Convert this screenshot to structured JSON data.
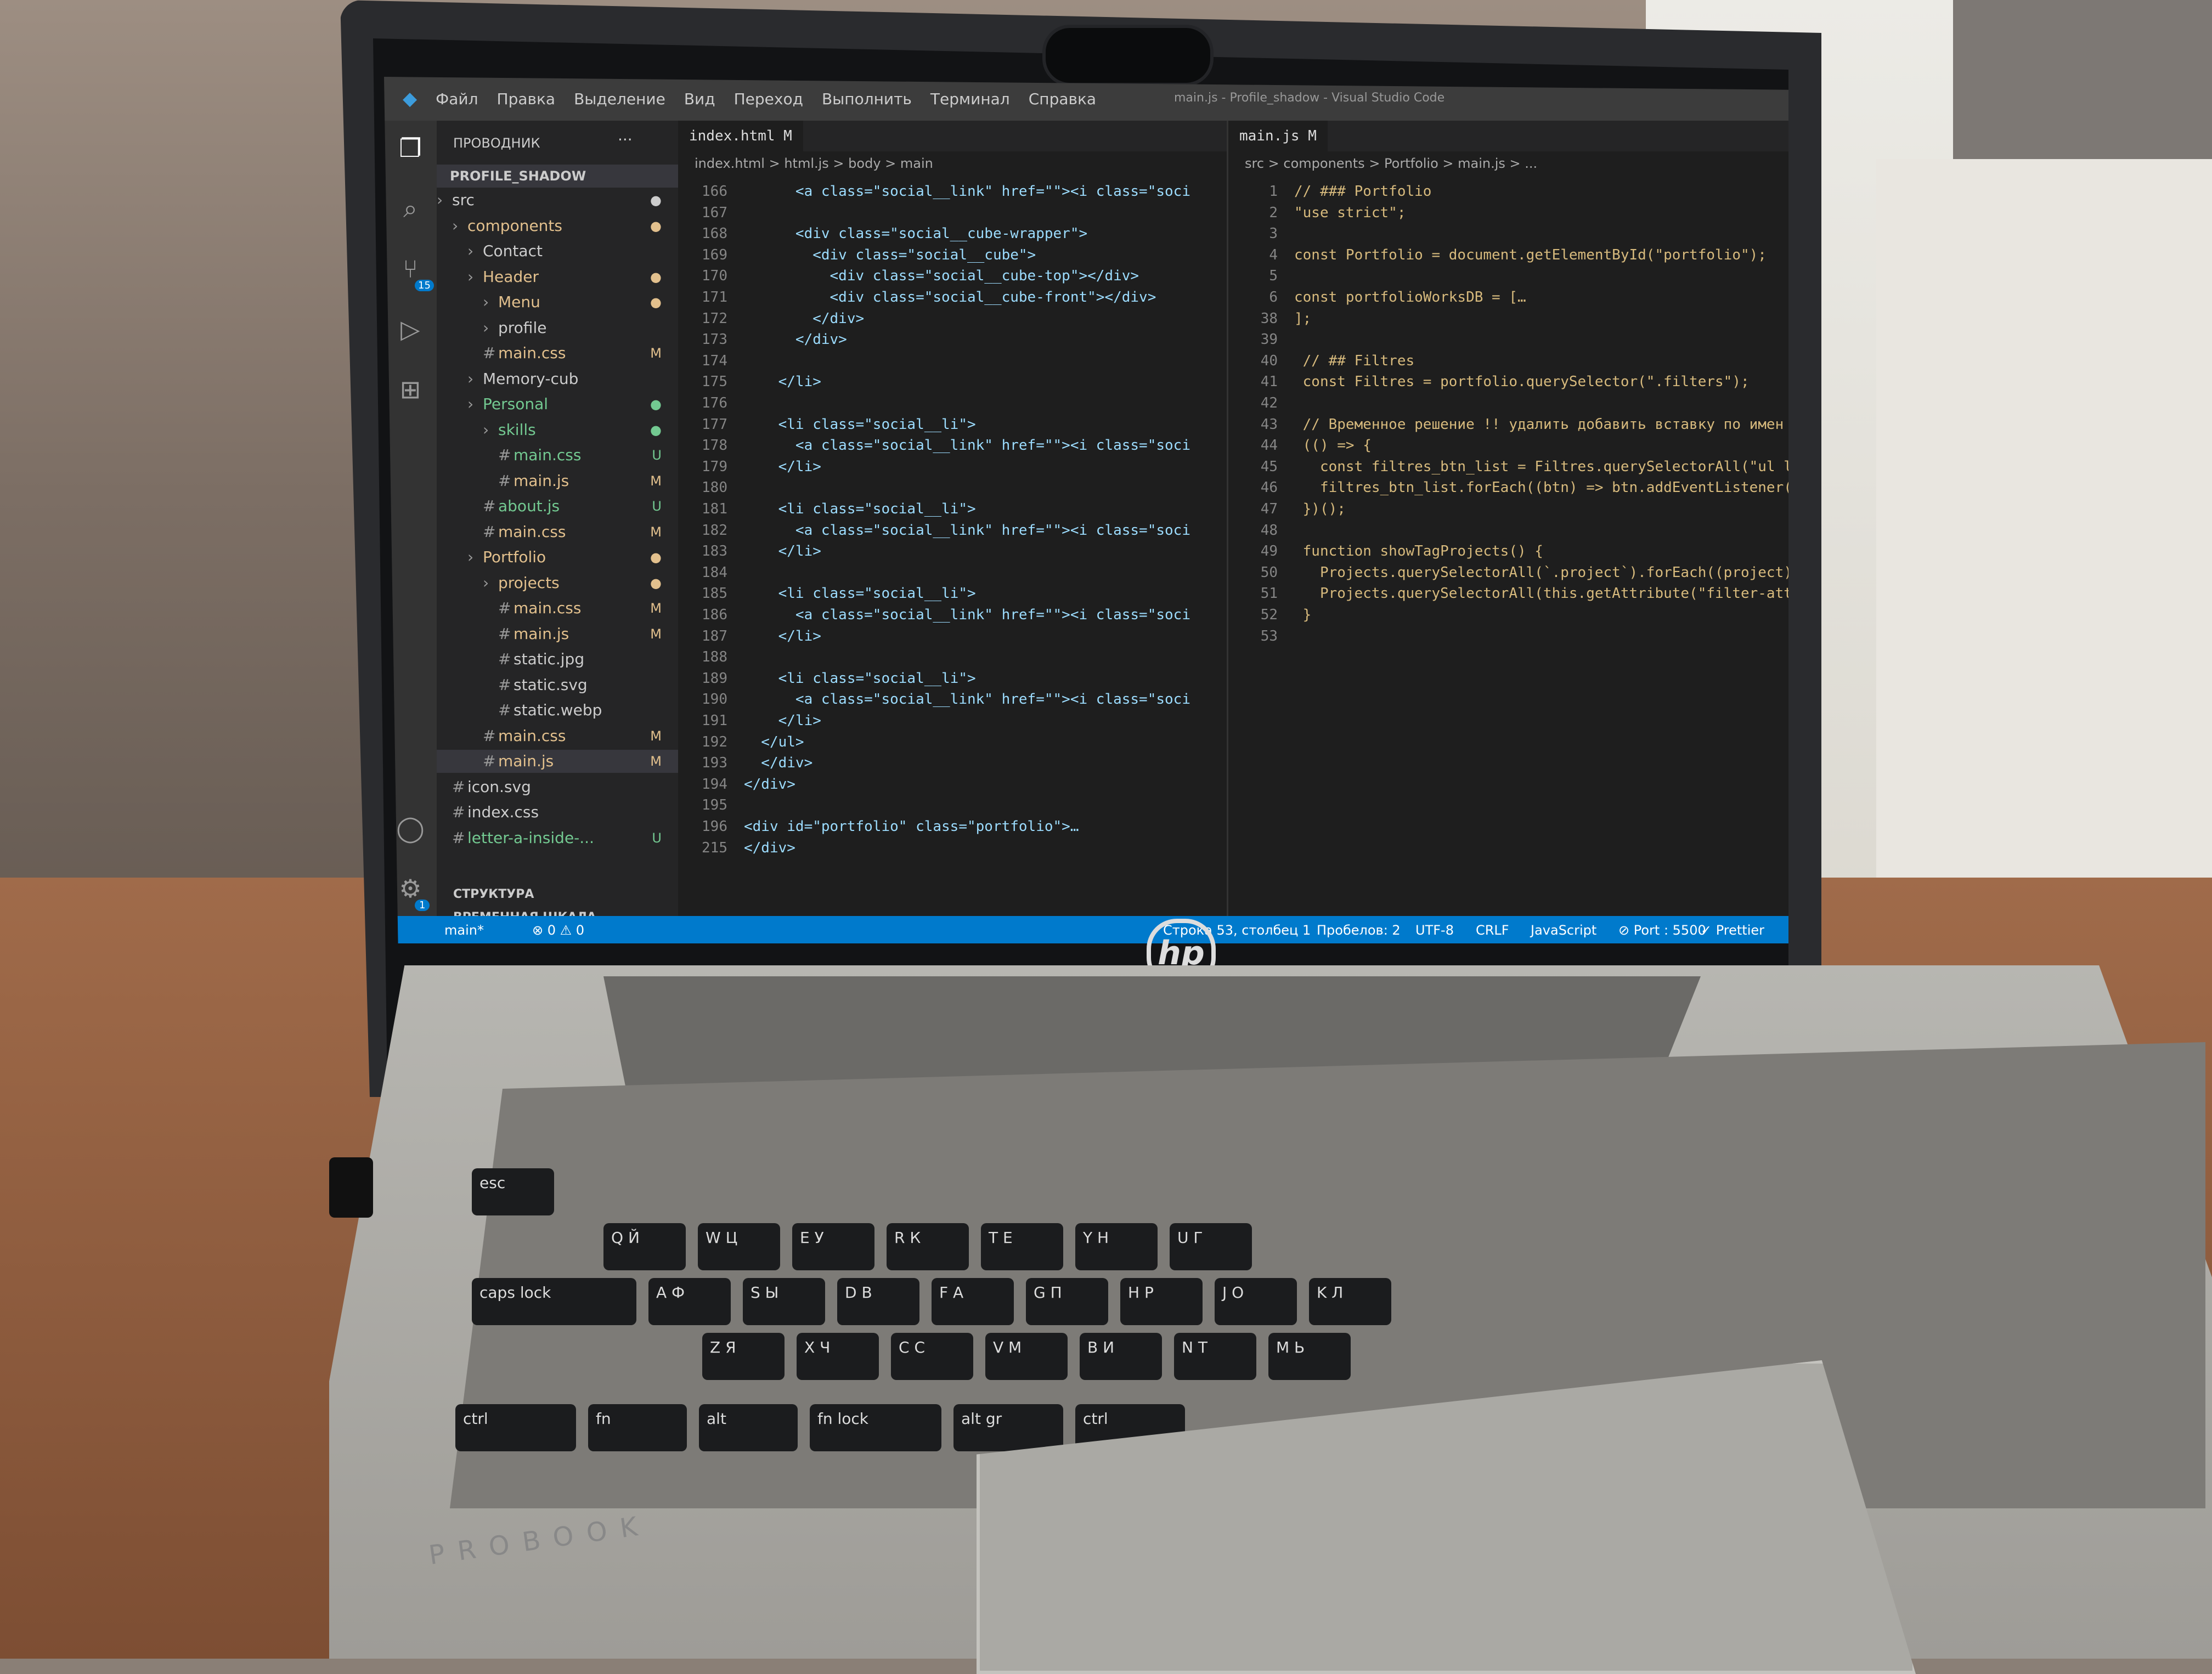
{
  "menu": [
    "Файл",
    "Правка",
    "Выделение",
    "Вид",
    "Переход",
    "Выполнить",
    "Терминал",
    "Справка"
  ],
  "window_title": "main.js - Profile_shadow - Visual Studio Code",
  "explorer": {
    "header": "ПРОВОДНИК",
    "project": "PROFILE_SHADOW",
    "items": [
      {
        "label": "src",
        "badge": "●"
      },
      {
        "label": "components",
        "badge": "●"
      },
      {
        "label": "Contact",
        "badge": ""
      },
      {
        "label": "Header",
        "badge": "●"
      },
      {
        "label": "Menu",
        "badge": "●"
      },
      {
        "label": "profile",
        "badge": ""
      },
      {
        "label": "main.css",
        "badge": "M"
      },
      {
        "label": "Memory-cub",
        "badge": ""
      },
      {
        "label": "Personal",
        "badge": "●"
      },
      {
        "label": "skills",
        "badge": "●"
      },
      {
        "label": "main.css",
        "badge": "U"
      },
      {
        "label": "main.js",
        "badge": "M"
      },
      {
        "label": "about.js",
        "badge": "U"
      },
      {
        "label": "main.css",
        "badge": "M"
      },
      {
        "label": "Portfolio",
        "badge": "●"
      },
      {
        "label": "projects",
        "badge": "●"
      },
      {
        "label": "main.css",
        "badge": "M"
      },
      {
        "label": "main.js",
        "badge": "M"
      },
      {
        "label": "static.jpg",
        "badge": ""
      },
      {
        "label": "static.svg",
        "badge": ""
      },
      {
        "label": "static.webp",
        "badge": ""
      },
      {
        "label": "main.css",
        "badge": "M"
      },
      {
        "label": "main.js",
        "badge": "M"
      },
      {
        "label": "icon.svg",
        "badge": ""
      },
      {
        "label": "index.css",
        "badge": ""
      },
      {
        "label": "letter-a-inside-...",
        "badge": "U"
      }
    ],
    "outline": "СТРУКТУРА",
    "timeline": "ВРЕМЕННАЯ ШКАЛА"
  },
  "editor1": {
    "tab": "index.html M",
    "breadcrumb": "index.html > html.js > body > main",
    "line_numbers": [
      "166",
      "167",
      "168",
      "169",
      "170",
      "171",
      "172",
      "173",
      "174",
      "175",
      "176",
      "177",
      "178",
      "179",
      "180",
      "181",
      "182",
      "183",
      "184",
      "185",
      "186",
      "187",
      "188",
      "189",
      "190",
      "191",
      "192",
      "193",
      "194",
      "195",
      "196",
      "215"
    ],
    "lines": [
      "      <a class=\"social__link\" href=\"\"><i class=\"soci",
      "",
      "      <div class=\"social__cube-wrapper\">",
      "        <div class=\"social__cube\">",
      "          <div class=\"social__cube-top\"></div>",
      "          <div class=\"social__cube-front\"></div>",
      "        </div>",
      "      </div>",
      "",
      "    </li>",
      "",
      "    <li class=\"social__li\">",
      "      <a class=\"social__link\" href=\"\"><i class=\"soci",
      "    </li>",
      "",
      "    <li class=\"social__li\">",
      "      <a class=\"social__link\" href=\"\"><i class=\"soci",
      "    </li>",
      "",
      "    <li class=\"social__li\">",
      "      <a class=\"social__link\" href=\"\"><i class=\"soci",
      "    </li>",
      "",
      "    <li class=\"social__li\">",
      "      <a class=\"social__link\" href=\"\"><i class=\"soci",
      "    </li>",
      "  </ul>",
      "  </div>",
      "</div>",
      "",
      "<div id=\"portfolio\" class=\"portfolio\">…",
      "</div>"
    ]
  },
  "editor2": {
    "tab": "main.js M",
    "breadcrumb": "src > components > Portfolio > main.js > ...",
    "line_numbers": [
      "1",
      "2",
      "3",
      "4",
      "5",
      "6",
      "38",
      "39",
      "40",
      "41",
      "42",
      "43",
      "44",
      "45",
      "46",
      "47",
      "48",
      "49",
      "50",
      "51",
      "52",
      "53"
    ],
    "lines": [
      "// ### Portfolio",
      "\"use strict\";",
      "",
      "const Portfolio = document.getElementById(\"portfolio\");",
      "",
      "const portfolioWorksDB = […",
      "];",
      "",
      " // ## Filtres",
      " const Filtres = portfolio.querySelector(\".filters\");",
      "",
      " // Временное решение !! удалить добавить вставку по имен",
      " (() => {",
      "   const filtres_btn_list = Filtres.querySelectorAll(\"ul li",
      "   filtres_btn_list.forEach((btn) => btn.addEventListener(\"c",
      " })();",
      "",
      " function showTagProjects() {",
      "   Projects.querySelectorAll(`.project`).forEach((project) =",
      "   Projects.querySelectorAll(this.getAttribute(\"filter-attri",
      " }",
      ""
    ]
  },
  "statusbar": {
    "branch": "main*",
    "problems": "⊗ 0 ⚠ 0",
    "position": "Строка 53, столбец 1",
    "spaces": "Пробелов: 2",
    "encoding": "UTF-8",
    "eol": "CRLF",
    "language": "JavaScript",
    "port": "⊘ Port : 5500",
    "prettier": "✓ Prettier"
  },
  "activity_badges": {
    "scm": "15",
    "settings": "1"
  },
  "laptop": {
    "logo": "hp",
    "brand": "PROBOOK"
  },
  "keys": [
    {
      "label": "esc"
    },
    {
      "label": "Q Й"
    },
    {
      "label": "W Ц"
    },
    {
      "label": "E У"
    },
    {
      "label": "R К"
    },
    {
      "label": "T Е"
    },
    {
      "label": "Y Н"
    },
    {
      "label": "U Г"
    },
    {
      "label": "caps lock"
    },
    {
      "label": "A Ф"
    },
    {
      "label": "S Ы"
    },
    {
      "label": "D В"
    },
    {
      "label": "F А"
    },
    {
      "label": "G П"
    },
    {
      "label": "H Р"
    },
    {
      "label": "J О"
    },
    {
      "label": "K Л"
    },
    {
      "label": "Z Я"
    },
    {
      "label": "X Ч"
    },
    {
      "label": "C С"
    },
    {
      "label": "V М"
    },
    {
      "label": "B И"
    },
    {
      "label": "N Т"
    },
    {
      "label": "M Ь"
    },
    {
      "label": "ctrl"
    },
    {
      "label": "fn"
    },
    {
      "label": "alt"
    },
    {
      "label": "fn lock"
    },
    {
      "label": "alt gr"
    },
    {
      "label": "ctrl"
    }
  ]
}
